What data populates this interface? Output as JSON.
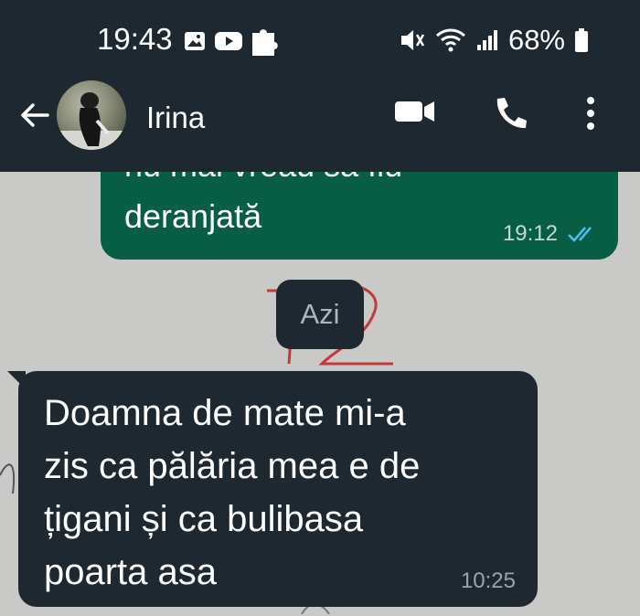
{
  "status_bar": {
    "time": "19:43",
    "battery": "68%",
    "left_icons": [
      "gallery-icon",
      "youtube-icon",
      "puzzle-icon"
    ],
    "right_icons": [
      "mute-vibrate-icon",
      "wifi-icon",
      "signal-icon",
      "battery-icon"
    ]
  },
  "app_bar": {
    "contact_name": "Irina",
    "actions": [
      "video-call-icon",
      "voice-call-icon",
      "more-options-icon"
    ]
  },
  "messages": {
    "outgoing": {
      "partial_line": "nu mai vreau să fiu",
      "text": "deranjată",
      "time": "19:12",
      "status": "read"
    },
    "date_chip": "Azi",
    "incoming": {
      "lines": [
        "Doamna de mate mi-a",
        "zis ca pălăria mea e de",
        "țigani și ca bulibasa",
        "poarta asa"
      ],
      "time": "10:25"
    }
  },
  "colors": {
    "header_bg": "#1e2830",
    "outgoing_bubble": "#075e45",
    "incoming_bubble": "#1e2830",
    "read_ticks": "#53bdeb",
    "wallpaper": "#c9c9c8"
  }
}
